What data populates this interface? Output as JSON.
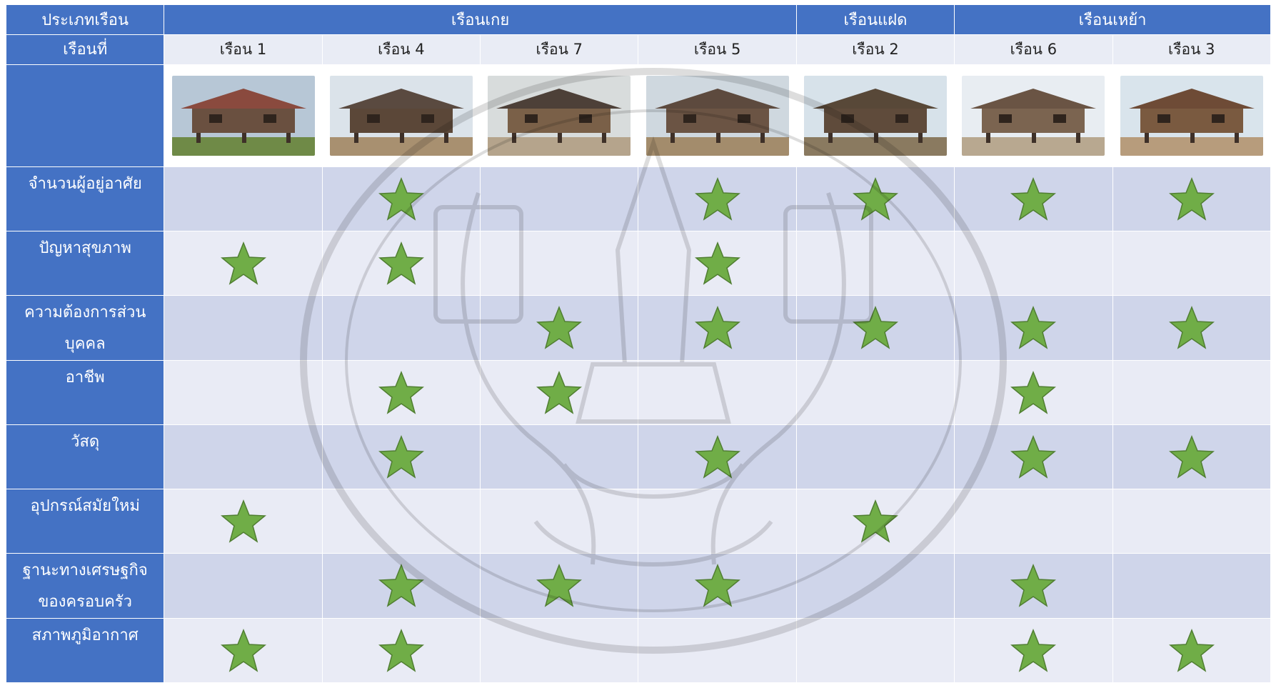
{
  "header": {
    "type_label": "ประเภทเรือน",
    "number_label": "เรือนที่",
    "groups": [
      {
        "label": "เรือนเกย",
        "span": 4
      },
      {
        "label": "เรือนแฝด",
        "span": 1
      },
      {
        "label": "เรือนเหย้า",
        "span": 2
      }
    ],
    "houses": [
      "เรือน 1",
      "เรือน 4",
      "เรือน 7",
      "เรือน 5",
      "เรือน 2",
      "เรือน 6",
      "เรือน 3"
    ]
  },
  "photos": [
    {
      "alt": "house-1-photo",
      "sky": "#b7c7d6",
      "roof": "#8a4a3e",
      "wall": "#6a5040",
      "ground": "#6f8a47"
    },
    {
      "alt": "house-4-photo",
      "sky": "#dbe3ea",
      "roof": "#5a4a40",
      "wall": "#5b4738",
      "ground": "#a89070"
    },
    {
      "alt": "house-7-photo",
      "sky": "#d8dcdc",
      "roof": "#4d4038",
      "wall": "#7a6048",
      "ground": "#b5a48c"
    },
    {
      "alt": "house-5-photo",
      "sky": "#cfd8df",
      "roof": "#5d4a3e",
      "wall": "#6b5444",
      "ground": "#a38c6c"
    },
    {
      "alt": "house-2-photo",
      "sky": "#d7e2ea",
      "roof": "#584838",
      "wall": "#5f4b3b",
      "ground": "#8a7a60"
    },
    {
      "alt": "house-6-photo",
      "sky": "#e8edf2",
      "roof": "#6a5444",
      "wall": "#7b6450",
      "ground": "#b8a890"
    },
    {
      "alt": "house-3-photo",
      "sky": "#d9e4ec",
      "roof": "#6e4b36",
      "wall": "#7a5a40",
      "ground": "#b79c7c"
    }
  ],
  "criteria": [
    {
      "label": [
        "จำนวนผู้อยู่อาศัย"
      ],
      "marks": [
        false,
        true,
        false,
        true,
        true,
        true,
        true
      ]
    },
    {
      "label": [
        "ปัญหาสุขภาพ"
      ],
      "marks": [
        true,
        true,
        false,
        true,
        false,
        false,
        false
      ]
    },
    {
      "label": [
        "ความต้องการส่วน",
        "บุคคล"
      ],
      "marks": [
        false,
        false,
        true,
        true,
        true,
        true,
        true
      ]
    },
    {
      "label": [
        "อาชีพ"
      ],
      "marks": [
        false,
        true,
        true,
        false,
        false,
        true,
        false
      ]
    },
    {
      "label": [
        "วัสดุ"
      ],
      "marks": [
        false,
        true,
        false,
        true,
        false,
        true,
        true
      ]
    },
    {
      "label": [
        "อุปกรณ์สมัยใหม่"
      ],
      "marks": [
        true,
        false,
        false,
        false,
        true,
        false,
        false
      ]
    },
    {
      "label": [
        "ฐานะทางเศรษฐกิจ",
        "ของครอบครัว"
      ],
      "marks": [
        false,
        true,
        true,
        true,
        false,
        true,
        false
      ]
    },
    {
      "label": [
        "สภาพภูมิอากาศ"
      ],
      "marks": [
        true,
        true,
        false,
        false,
        false,
        true,
        true
      ]
    }
  ],
  "colors": {
    "header_blue": "#4472c4",
    "row_dark": "#cfd5ea",
    "row_light": "#e9ebf5",
    "star_fill": "#70ad47",
    "star_stroke": "#507e32"
  },
  "icons": {
    "mark": "star-icon",
    "watermark": "university-seal-watermark"
  }
}
